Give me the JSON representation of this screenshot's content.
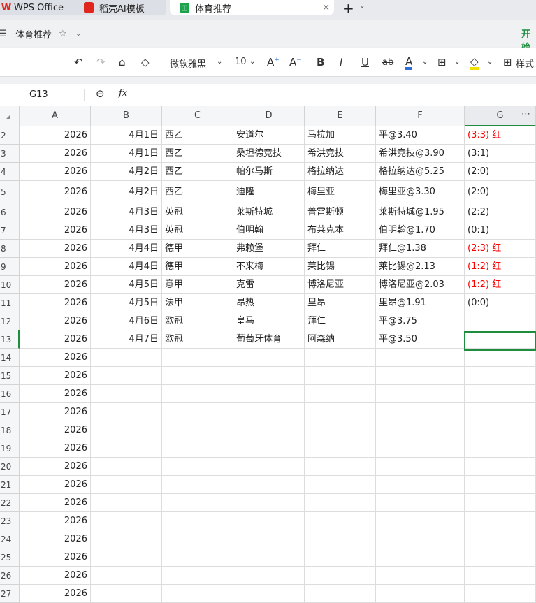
{
  "tabs": [
    {
      "label": "WPS Office",
      "icon": "wps-logo-icon"
    },
    {
      "label": "稻壳AI模板",
      "icon": "docer-icon"
    },
    {
      "label": "体育推荐",
      "icon": "spreadsheet-icon",
      "active": true
    }
  ],
  "title": {
    "doc_name": "体育推荐",
    "menu_start": "开始"
  },
  "toolbar": {
    "font_name": "微软雅黑",
    "font_size": "10",
    "styles_label": "样式"
  },
  "formula": {
    "cell_ref": "G13",
    "fx": "fx",
    "value": ""
  },
  "columns": [
    "A",
    "B",
    "C",
    "D",
    "E",
    "F",
    "G"
  ],
  "rows": [
    {
      "n": "2",
      "a": "2026",
      "b": "4月1日",
      "c": "西乙",
      "d": "安道尔",
      "e": "马拉加",
      "f": "平@3.40",
      "g": "(3:3) 红",
      "red": true
    },
    {
      "n": "3",
      "a": "2026",
      "b": "4月1日",
      "c": "西乙",
      "d": "桑坦德竞技",
      "e": "希洪竞技",
      "f": "希洪竞技@3.90",
      "g": "(3:1)",
      "red": false
    },
    {
      "n": "4",
      "a": "2026",
      "b": "4月2日",
      "c": "西乙",
      "d": "帕尔马斯",
      "e": "格拉纳达",
      "f": "格拉纳达@5.25",
      "g": "(2:0)",
      "red": false
    },
    {
      "n": "5",
      "a": "2026",
      "b": "4月2日",
      "c": "西乙",
      "d": "迪隆",
      "e": "梅里亚",
      "f": "梅里亚@3.30",
      "g": "(2:0)",
      "red": false
    },
    {
      "n": "6",
      "a": "2026",
      "b": "4月3日",
      "c": "英冠",
      "d": "莱斯特城",
      "e": "普雷斯顿",
      "f": "莱斯特城@1.95",
      "g": "(2:2)",
      "red": false
    },
    {
      "n": "7",
      "a": "2026",
      "b": "4月3日",
      "c": "英冠",
      "d": "伯明翰",
      "e": "布莱克本",
      "f": "伯明翰@1.70",
      "g": "(0:1)",
      "red": false
    },
    {
      "n": "8",
      "a": "2026",
      "b": "4月4日",
      "c": "德甲",
      "d": "弗赖堡",
      "e": "拜仁",
      "f": "拜仁@1.38",
      "g": "(2:3) 红",
      "red": true
    },
    {
      "n": "9",
      "a": "2026",
      "b": "4月4日",
      "c": "德甲",
      "d": "不来梅",
      "e": "莱比锡",
      "f": "莱比锡@2.13",
      "g": "(1:2) 红",
      "red": true
    },
    {
      "n": "10",
      "a": "2026",
      "b": "4月5日",
      "c": "意甲",
      "d": "克雷",
      "e": "博洛尼亚",
      "f": "博洛尼亚@2.03",
      "g": "(1:2) 红",
      "red": true
    },
    {
      "n": "11",
      "a": "2026",
      "b": "4月5日",
      "c": "法甲",
      "d": "昂热",
      "e": "里昂",
      "f": "里昂@1.91",
      "g": "(0:0)",
      "red": false
    },
    {
      "n": "12",
      "a": "2026",
      "b": "4月6日",
      "c": "欧冠",
      "d": "皇马",
      "e": "拜仁",
      "f": "平@3.75",
      "g": "",
      "red": false
    },
    {
      "n": "13",
      "a": "2026",
      "b": "4月7日",
      "c": "欧冠",
      "d": "葡萄牙体育",
      "e": "阿森纳",
      "f": "平@3.50",
      "g": "",
      "red": false
    },
    {
      "n": "14",
      "a": "2026"
    },
    {
      "n": "15",
      "a": "2026"
    },
    {
      "n": "16",
      "a": "2026"
    },
    {
      "n": "17",
      "a": "2026"
    },
    {
      "n": "18",
      "a": "2026"
    },
    {
      "n": "19",
      "a": "2026"
    },
    {
      "n": "20",
      "a": "2026"
    },
    {
      "n": "21",
      "a": "2026"
    },
    {
      "n": "22",
      "a": "2026"
    },
    {
      "n": "23",
      "a": "2026"
    },
    {
      "n": "24",
      "a": "2026"
    },
    {
      "n": "25",
      "a": "2026"
    },
    {
      "n": "26",
      "a": "2026"
    },
    {
      "n": "27",
      "a": "2026"
    }
  ],
  "colors": {
    "accent": "#1e8e3e",
    "red": "#ff0000"
  }
}
